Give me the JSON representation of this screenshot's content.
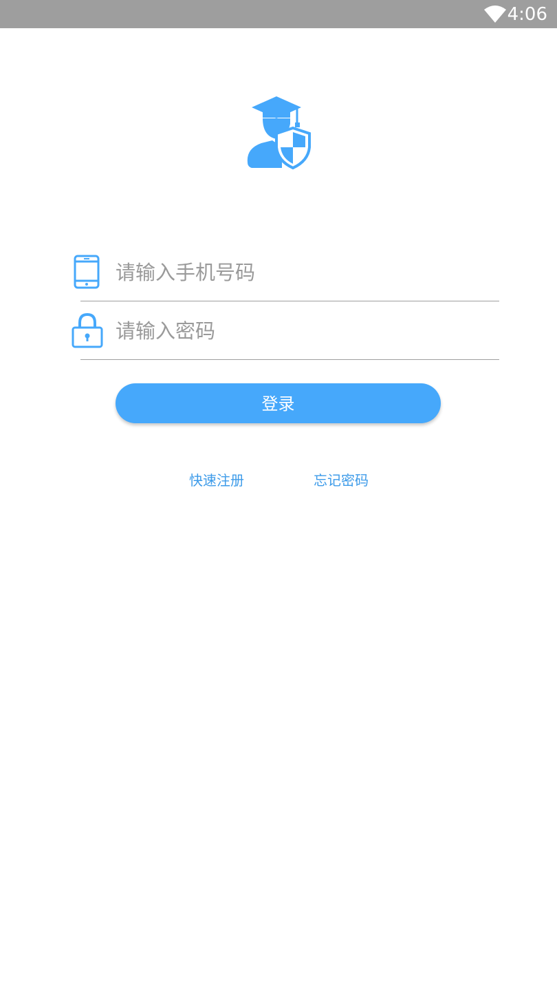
{
  "status_bar": {
    "time": "4:06",
    "wifi_icon": "wifi-icon"
  },
  "logo": {
    "icon": "graduate-shield-icon",
    "color": "#46a8fb"
  },
  "phone_field": {
    "icon": "phone-icon",
    "placeholder": "请输入手机号码",
    "value": ""
  },
  "password_field": {
    "icon": "lock-icon",
    "placeholder": "请输入密码",
    "value": ""
  },
  "login_button": {
    "label": "登录"
  },
  "links": {
    "register": "快速注册",
    "forgot_password": "忘记密码"
  },
  "colors": {
    "accent": "#46a8fb",
    "link": "#3d9be9",
    "status_bar": "#9e9e9e"
  }
}
